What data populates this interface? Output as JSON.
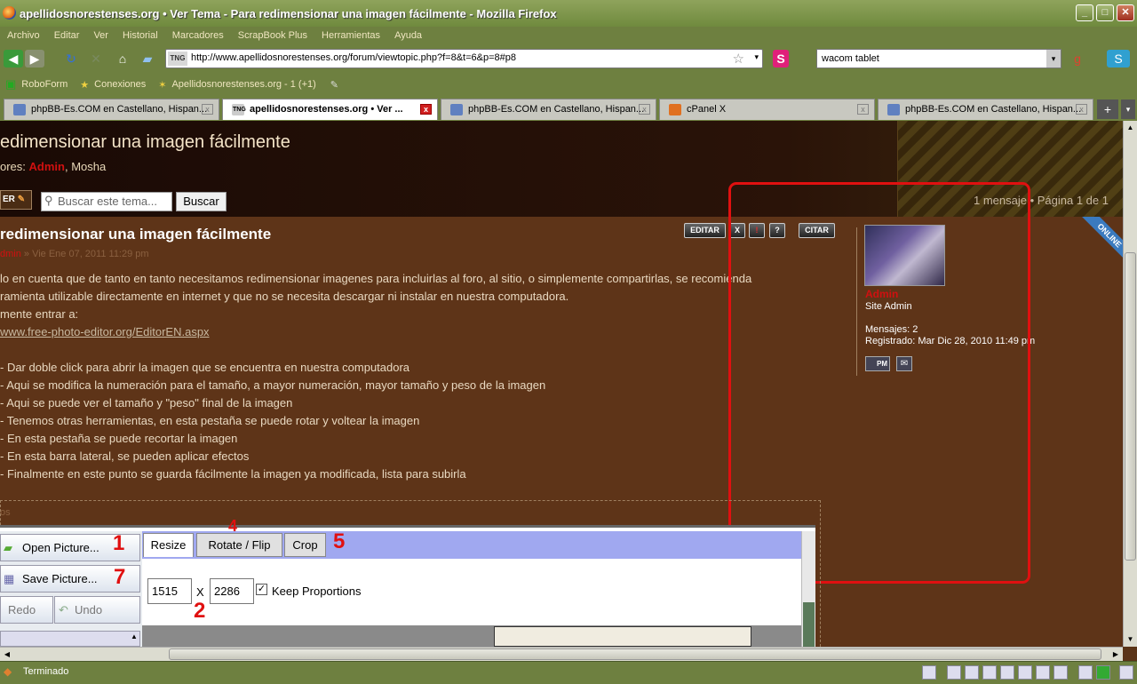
{
  "window": {
    "title": "apellidosnorestenses.org • Ver Tema - Para redimensionar una imagen fácilmente - Mozilla Firefox"
  },
  "menu": [
    "Archivo",
    "Editar",
    "Ver",
    "Historial",
    "Marcadores",
    "ScrapBook Plus",
    "Herramientas",
    "Ayuda"
  ],
  "url": "http://www.apellidosnorestenses.org/forum/viewtopic.php?f=8&t=6&p=8#p8",
  "url_badge": "TNG",
  "search_engine_query": "wacom tablet",
  "bookmarks": [
    "RoboForm",
    "Conexiones",
    "Apellidosnorestenses.org - 1 (+1)"
  ],
  "tabs": [
    {
      "label": "phpBB-Es.COM en Castellano, Hispan...",
      "active": false,
      "close": "x"
    },
    {
      "label": "apellidosnorestenses.org • Ver ...",
      "active": true,
      "close": "x"
    },
    {
      "label": "phpBB-Es.COM en Castellano, Hispan...",
      "active": false,
      "close": "x"
    },
    {
      "label": "cPanel X",
      "active": false,
      "close": "x"
    },
    {
      "label": "phpBB-Es.COM en Castellano, Hispan...",
      "active": false,
      "close": "x"
    }
  ],
  "header": {
    "topic_title": "edimensionar una imagen fácilmente",
    "moderators_label": "ores:",
    "moderator_admin": "Admin",
    "moderator_other": ", Mosha",
    "reply_button": "ER",
    "search_placeholder": "Buscar este tema...",
    "search_button": "Buscar",
    "pagination": "1 mensaje • Página 1 de 1"
  },
  "post": {
    "title": "redimensionar una imagen fácilmente",
    "author": "dmin",
    "date": " » Vie Ene 07, 2011 11:29 pm",
    "buttons": {
      "edit": "EDITAR",
      "delete": "X",
      "report": "!",
      "info": "?",
      "quote": "CITAR"
    },
    "lines": [
      "lo en cuenta que de tanto en tanto necesitamos redimensionar imagenes para incluirlas al foro, al sitio, o simplemente compartirlas, se recomienda",
      "ramienta utilizable directamente en internet y que no se necesita descargar ni instalar en nuestra computadora.",
      "mente entrar a:",
      "www.free-photo-editor.org/EditorEN.aspx",
      "- Dar doble click para abrir la imagen que se encuentra en nuestra computadora",
      "- Aqui se modifica la numeración para el tamaño, a mayor numeración, mayor tamaño y peso de la imagen",
      "- Aqui se puede ver el tamaño y \"peso\" final de la imagen",
      "- Tenemos otras herramientas, en esta pestaña se puede rotar y voltear la imagen",
      "- En esta pestaña se puede recortar la imagen",
      "- En esta barra lateral, se pueden aplicar efectos",
      "- Finalmente en este punto se guarda fácilmente la imagen ya modificada, lista para subirla"
    ],
    "attachment_label": "os"
  },
  "profile": {
    "online_badge": "ONLINE",
    "username": "Admin",
    "rank": "Site Admin",
    "posts_label": "Mensajes:",
    "posts_value": "2",
    "registered_label": "Registrado:",
    "registered_value": "Mar Dic 28, 2010 11:49 pm",
    "pm_label": "PM"
  },
  "editor": {
    "open_picture": "Open Picture...",
    "save_picture": "Save Picture...",
    "redo": "Redo",
    "undo": "Undo",
    "tabs": [
      "Resize",
      "Rotate / Flip",
      "Crop"
    ],
    "width": "1515",
    "height": "2286",
    "times": "X",
    "keep_proportions": "Keep Proportions",
    "annotations": {
      "n1": "1",
      "n2": "2",
      "n4": "4",
      "n5": "5",
      "n7": "7"
    }
  },
  "status": {
    "text": "Terminado"
  },
  "colors": {
    "annotation": "#e01010",
    "chrome": "#6e8040",
    "page_bg": "#5e3418"
  }
}
